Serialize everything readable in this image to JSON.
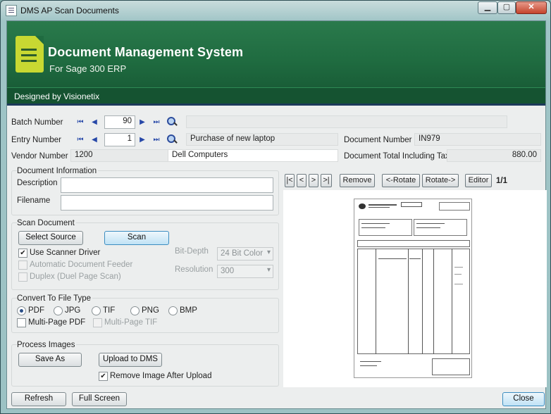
{
  "window": {
    "title": "DMS AP Scan Documents",
    "minimize": "▁",
    "maximize": "▢",
    "close": "✕"
  },
  "banner": {
    "title": "Document Management System",
    "subtitle": "For Sage 300 ERP",
    "designed_by": "Designed by Visionetix"
  },
  "header": {
    "batch_label": "Batch Number",
    "batch_value": "90",
    "entry_label": "Entry Number",
    "entry_value": "1",
    "entry_description": "Purchase of new laptop",
    "doc_number_label": "Document Number",
    "doc_number_value": "IN979",
    "vendor_label": "Vendor Number",
    "vendor_value": "1200",
    "vendor_name": "Dell Computers",
    "doc_total_label": "Document Total Including Tax",
    "doc_total_value": "880.00"
  },
  "doc_info": {
    "title": "Document Information",
    "description_label": "Description",
    "description_value": "",
    "filename_label": "Filename",
    "filename_value": ""
  },
  "scan": {
    "title": "Scan Document",
    "select_source": "Select Source",
    "scan_button": "Scan",
    "use_scanner_driver": "Use Scanner Driver",
    "use_scanner_driver_checked": true,
    "auto_feeder": "Automatic Document Feeder",
    "duplex": "Duplex (Duel Page Scan)",
    "bit_depth_label": "Bit-Depth",
    "bit_depth_value": "24 Bit Color",
    "resolution_label": "Resolution",
    "resolution_value": "300"
  },
  "convert": {
    "title": "Convert To File Type",
    "options": [
      "PDF",
      "JPG",
      "TIF",
      "PNG",
      "BMP"
    ],
    "selected": "PDF",
    "multipage_pdf": "Multi-Page PDF",
    "multipage_tif": "Multi-Page TIF"
  },
  "process": {
    "title": "Process Images",
    "save_as": "Save As",
    "upload": "Upload to DMS",
    "remove_after_upload": "Remove Image After Upload",
    "remove_checked": true
  },
  "viewer": {
    "first": "|<",
    "prev": "<",
    "next": ">",
    "last": ">|",
    "remove": "Remove",
    "rotate_left": "<-Rotate",
    "rotate_right": "Rotate->",
    "editor": "Editor",
    "page_indicator": "1/1"
  },
  "footer": {
    "refresh": "Refresh",
    "full_screen": "Full Screen",
    "close": "Close"
  },
  "nav_icons": {
    "first": "⏮",
    "prev": "◀",
    "next": "▶",
    "last": "⏭"
  }
}
